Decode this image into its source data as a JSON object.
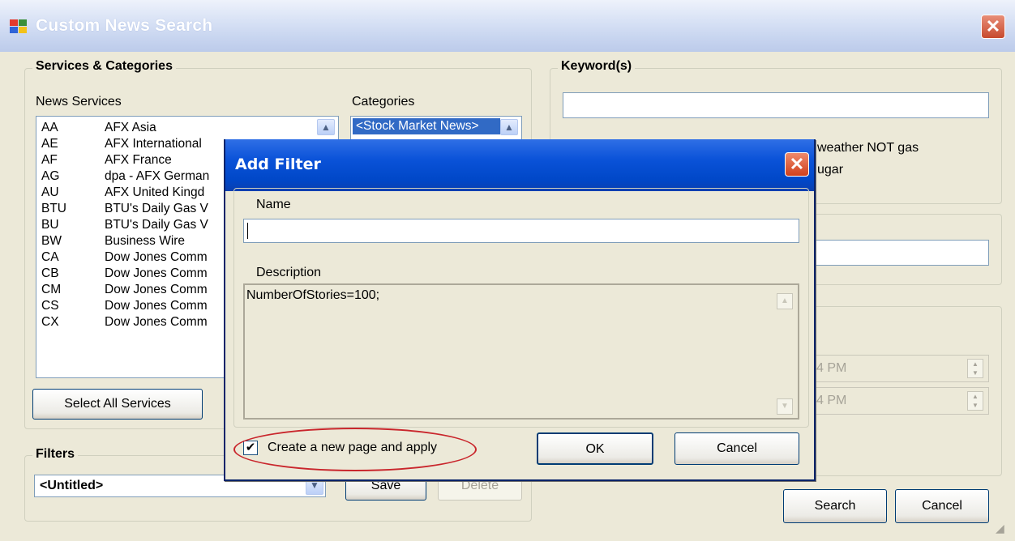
{
  "window": {
    "title": "Custom News Search",
    "close_label": "✕"
  },
  "services_group": {
    "label": "Services & Categories",
    "news_services_label": "News Services",
    "categories_label": "Categories",
    "services": [
      {
        "code": "AA",
        "name": "AFX Asia"
      },
      {
        "code": "AE",
        "name": "AFX International"
      },
      {
        "code": "AF",
        "name": "AFX France"
      },
      {
        "code": "AG",
        "name": "dpa - AFX German"
      },
      {
        "code": "AU",
        "name": "AFX United Kingd"
      },
      {
        "code": "BTU",
        "name": "BTU's Daily Gas V"
      },
      {
        "code": "BU",
        "name": "BTU's Daily Gas V"
      },
      {
        "code": "BW",
        "name": "Business Wire"
      },
      {
        "code": "CA",
        "name": "Dow Jones Comm"
      },
      {
        "code": "CB",
        "name": "Dow Jones Comm"
      },
      {
        "code": "CM",
        "name": "Dow Jones Comm"
      },
      {
        "code": "CS",
        "name": "Dow Jones Comm"
      },
      {
        "code": "CX",
        "name": "Dow Jones Comm"
      }
    ],
    "categories": [
      "<Stock Market News>"
    ],
    "select_all_label": "Select All Services"
  },
  "filters_group": {
    "label": "Filters",
    "selected": "<Untitled>",
    "save_label": "Save",
    "delete_label": "Delete"
  },
  "keywords_group": {
    "label": "Keyword(s)",
    "value": "",
    "hint_line1": "weather NOT gas",
    "hint_line2": "ugar"
  },
  "time_group": {
    "from_value": "4 PM",
    "to_value": "4 PM"
  },
  "main_buttons": {
    "search_label": "Search",
    "cancel_label": "Cancel"
  },
  "dialog": {
    "title": "Add Filter",
    "close_label": "✕",
    "name_label": "Name",
    "name_value": "",
    "description_label": "Description",
    "description_value": "NumberOfStories=100;",
    "checkbox_label": "Create a new page and apply",
    "checkbox_checked": true,
    "ok_label": "OK",
    "cancel_label": "Cancel"
  },
  "colors": {
    "dialog_title": "#0a52d8",
    "highlight": "#c9262c",
    "selection": "#316ac5"
  }
}
